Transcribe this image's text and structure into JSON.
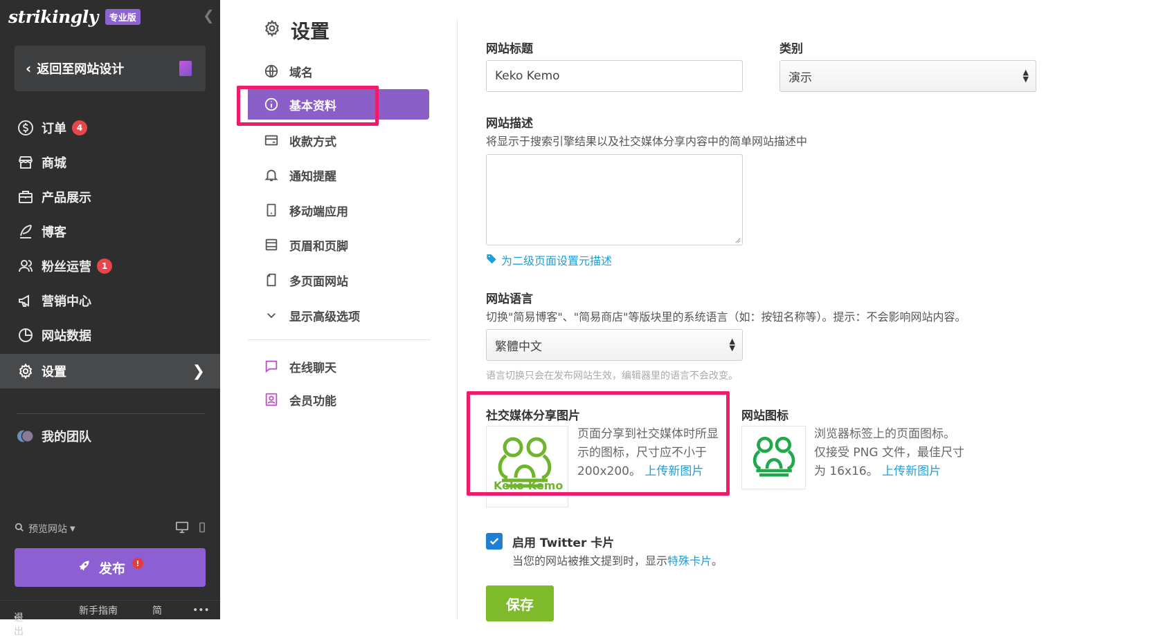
{
  "sidebar": {
    "logo": "strikingly",
    "plan_badge": "专业版",
    "back_label": "返回至网站设计",
    "items": [
      {
        "label": "订单",
        "badge": "4"
      },
      {
        "label": "商城"
      },
      {
        "label": "产品展示"
      },
      {
        "label": "博客"
      },
      {
        "label": "粉丝运营",
        "badge": "1"
      },
      {
        "label": "营销中心"
      },
      {
        "label": "网站数据"
      },
      {
        "label": "设置"
      },
      {
        "label": "我的团队"
      }
    ],
    "preview_label": "预览网站",
    "publish_label": "发布",
    "publish_warning": "!",
    "bottom": {
      "logout": "退出",
      "guide": "新手指南",
      "lang": "简",
      "more": "•••"
    }
  },
  "settings_nav": {
    "title": "设置",
    "items": [
      {
        "label": "域名"
      },
      {
        "label": "基本资料"
      },
      {
        "label": "收款方式"
      },
      {
        "label": "通知提醒"
      },
      {
        "label": "移动端应用"
      },
      {
        "label": "页眉和页脚"
      },
      {
        "label": "多页面网站"
      },
      {
        "label": "显示高级选项"
      },
      {
        "label": "在线聊天"
      },
      {
        "label": "会员功能"
      }
    ]
  },
  "form": {
    "site_title_label": "网站标题",
    "site_title_value": "Keko Kemo",
    "category_label": "类别",
    "category_value": "演示",
    "description_label": "网站描述",
    "description_hint": "将显示于搜索引擎结果以及社交媒体分享内容中的简单网站描述中",
    "meta_link": "为二级页面设置元描述",
    "language_label": "网站语言",
    "language_hint": "切换\"简易博客\"、\"简易商店\"等版块里的系统语言（如：按钮名称等）。提示：不会影响网站内容。",
    "language_value": "繁體中文",
    "language_note": "语言切换只会在发布网站生效，编辑器里的语言不会改变。",
    "social_image_label": "社交媒体分享图片",
    "social_image_desc_1": "页面分享到社交媒体时所显",
    "social_image_desc_2": "示的图标，尺寸应不小于",
    "social_image_desc_3": "200x200。",
    "social_upload_link": "上传新图片",
    "social_thumb_text": "Keko Kemo",
    "favicon_label": "网站图标",
    "favicon_desc_1": "浏览器标签上的页面图标。",
    "favicon_desc_2": "仅接受 PNG 文件，最佳尺寸",
    "favicon_desc_3": "为 16x16。",
    "favicon_upload_link": "上传新图片",
    "twitter_label": "启用 Twitter 卡片",
    "twitter_hint": "当您的网站被推文提到时，显示",
    "twitter_link": "特殊卡片",
    "twitter_hint_end": "。",
    "save_label": "保存"
  },
  "colors": {
    "sidebar_bg": "#2e2e2f",
    "accent_purple": "#8a5fc8",
    "highlight_pink": "#ee1c6a",
    "link_blue": "#1e9fd8",
    "save_green": "#7fb92c",
    "frog_green": "#6fb52c"
  }
}
